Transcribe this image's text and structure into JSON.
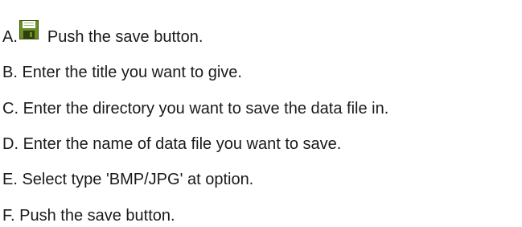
{
  "steps": [
    {
      "letter": "A.",
      "text": "Push the save button.",
      "icon": "floppy-disk-save-icon"
    },
    {
      "letter": "B.",
      "text": "Enter the title you want to give."
    },
    {
      "letter": "C.",
      "text": "Enter the directory you want to save the data file in."
    },
    {
      "letter": "D.",
      "text": "Enter the name of data file you want to save."
    },
    {
      "letter": "E.",
      "text": "Select type 'BMP/JPG' at option."
    },
    {
      "letter": "F.",
      "text": "Push the save button."
    }
  ],
  "colors": {
    "text": "#1a1a1a",
    "icon_body": "#6b8e23",
    "icon_dark": "#2f3f0f",
    "icon_label": "#ffffff"
  }
}
